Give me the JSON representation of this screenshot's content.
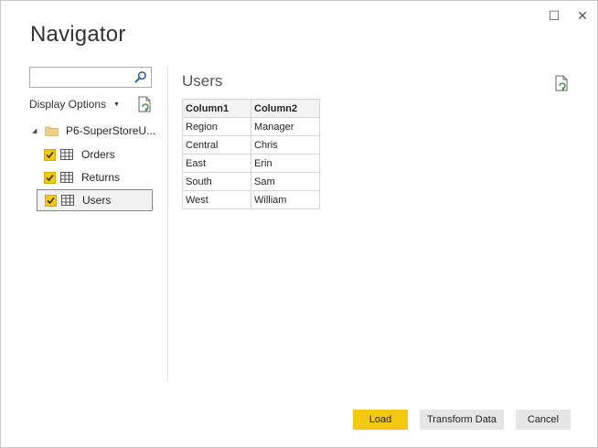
{
  "window": {
    "title": "Navigator",
    "controls": {
      "maximize": "☐",
      "close": "✕"
    }
  },
  "left": {
    "search": {
      "value": "",
      "placeholder": ""
    },
    "display_options": "Display Options",
    "tree": {
      "folder": "P6-SuperStoreU...",
      "items": [
        {
          "label": "Orders",
          "checked": true
        },
        {
          "label": "Returns",
          "checked": true
        },
        {
          "label": "Users",
          "checked": true,
          "selected": true
        }
      ]
    }
  },
  "preview": {
    "title": "Users",
    "headers": [
      "Column1",
      "Column2"
    ],
    "rows": [
      [
        "Region",
        "Manager"
      ],
      [
        "Central",
        "Chris"
      ],
      [
        "East",
        "Erin"
      ],
      [
        "South",
        "Sam"
      ],
      [
        "West",
        "William"
      ]
    ]
  },
  "footer": {
    "load": "Load",
    "transform": "Transform Data",
    "cancel": "Cancel"
  },
  "colors": {
    "accent": "#f2c811",
    "button_gray": "#e6e6e6"
  }
}
